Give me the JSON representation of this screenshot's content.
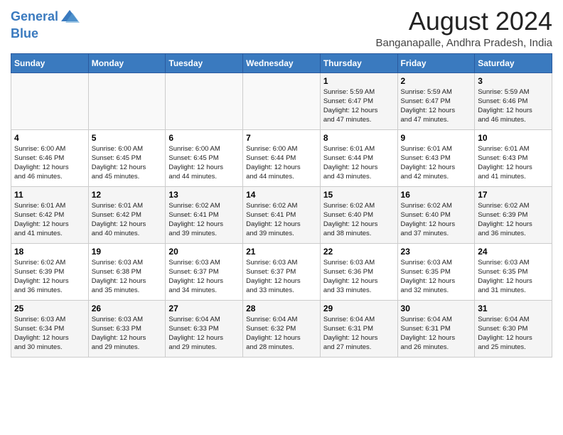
{
  "header": {
    "logo_line1": "General",
    "logo_line2": "Blue",
    "month": "August 2024",
    "location": "Banganapalle, Andhra Pradesh, India"
  },
  "days_of_week": [
    "Sunday",
    "Monday",
    "Tuesday",
    "Wednesday",
    "Thursday",
    "Friday",
    "Saturday"
  ],
  "weeks": [
    [
      {
        "day": "",
        "info": ""
      },
      {
        "day": "",
        "info": ""
      },
      {
        "day": "",
        "info": ""
      },
      {
        "day": "",
        "info": ""
      },
      {
        "day": "1",
        "info": "Sunrise: 5:59 AM\nSunset: 6:47 PM\nDaylight: 12 hours\nand 47 minutes."
      },
      {
        "day": "2",
        "info": "Sunrise: 5:59 AM\nSunset: 6:47 PM\nDaylight: 12 hours\nand 47 minutes."
      },
      {
        "day": "3",
        "info": "Sunrise: 5:59 AM\nSunset: 6:46 PM\nDaylight: 12 hours\nand 46 minutes."
      }
    ],
    [
      {
        "day": "4",
        "info": "Sunrise: 6:00 AM\nSunset: 6:46 PM\nDaylight: 12 hours\nand 46 minutes."
      },
      {
        "day": "5",
        "info": "Sunrise: 6:00 AM\nSunset: 6:45 PM\nDaylight: 12 hours\nand 45 minutes."
      },
      {
        "day": "6",
        "info": "Sunrise: 6:00 AM\nSunset: 6:45 PM\nDaylight: 12 hours\nand 44 minutes."
      },
      {
        "day": "7",
        "info": "Sunrise: 6:00 AM\nSunset: 6:44 PM\nDaylight: 12 hours\nand 44 minutes."
      },
      {
        "day": "8",
        "info": "Sunrise: 6:01 AM\nSunset: 6:44 PM\nDaylight: 12 hours\nand 43 minutes."
      },
      {
        "day": "9",
        "info": "Sunrise: 6:01 AM\nSunset: 6:43 PM\nDaylight: 12 hours\nand 42 minutes."
      },
      {
        "day": "10",
        "info": "Sunrise: 6:01 AM\nSunset: 6:43 PM\nDaylight: 12 hours\nand 41 minutes."
      }
    ],
    [
      {
        "day": "11",
        "info": "Sunrise: 6:01 AM\nSunset: 6:42 PM\nDaylight: 12 hours\nand 41 minutes."
      },
      {
        "day": "12",
        "info": "Sunrise: 6:01 AM\nSunset: 6:42 PM\nDaylight: 12 hours\nand 40 minutes."
      },
      {
        "day": "13",
        "info": "Sunrise: 6:02 AM\nSunset: 6:41 PM\nDaylight: 12 hours\nand 39 minutes."
      },
      {
        "day": "14",
        "info": "Sunrise: 6:02 AM\nSunset: 6:41 PM\nDaylight: 12 hours\nand 39 minutes."
      },
      {
        "day": "15",
        "info": "Sunrise: 6:02 AM\nSunset: 6:40 PM\nDaylight: 12 hours\nand 38 minutes."
      },
      {
        "day": "16",
        "info": "Sunrise: 6:02 AM\nSunset: 6:40 PM\nDaylight: 12 hours\nand 37 minutes."
      },
      {
        "day": "17",
        "info": "Sunrise: 6:02 AM\nSunset: 6:39 PM\nDaylight: 12 hours\nand 36 minutes."
      }
    ],
    [
      {
        "day": "18",
        "info": "Sunrise: 6:02 AM\nSunset: 6:39 PM\nDaylight: 12 hours\nand 36 minutes."
      },
      {
        "day": "19",
        "info": "Sunrise: 6:03 AM\nSunset: 6:38 PM\nDaylight: 12 hours\nand 35 minutes."
      },
      {
        "day": "20",
        "info": "Sunrise: 6:03 AM\nSunset: 6:37 PM\nDaylight: 12 hours\nand 34 minutes."
      },
      {
        "day": "21",
        "info": "Sunrise: 6:03 AM\nSunset: 6:37 PM\nDaylight: 12 hours\nand 33 minutes."
      },
      {
        "day": "22",
        "info": "Sunrise: 6:03 AM\nSunset: 6:36 PM\nDaylight: 12 hours\nand 33 minutes."
      },
      {
        "day": "23",
        "info": "Sunrise: 6:03 AM\nSunset: 6:35 PM\nDaylight: 12 hours\nand 32 minutes."
      },
      {
        "day": "24",
        "info": "Sunrise: 6:03 AM\nSunset: 6:35 PM\nDaylight: 12 hours\nand 31 minutes."
      }
    ],
    [
      {
        "day": "25",
        "info": "Sunrise: 6:03 AM\nSunset: 6:34 PM\nDaylight: 12 hours\nand 30 minutes."
      },
      {
        "day": "26",
        "info": "Sunrise: 6:03 AM\nSunset: 6:33 PM\nDaylight: 12 hours\nand 29 minutes."
      },
      {
        "day": "27",
        "info": "Sunrise: 6:04 AM\nSunset: 6:33 PM\nDaylight: 12 hours\nand 29 minutes."
      },
      {
        "day": "28",
        "info": "Sunrise: 6:04 AM\nSunset: 6:32 PM\nDaylight: 12 hours\nand 28 minutes."
      },
      {
        "day": "29",
        "info": "Sunrise: 6:04 AM\nSunset: 6:31 PM\nDaylight: 12 hours\nand 27 minutes."
      },
      {
        "day": "30",
        "info": "Sunrise: 6:04 AM\nSunset: 6:31 PM\nDaylight: 12 hours\nand 26 minutes."
      },
      {
        "day": "31",
        "info": "Sunrise: 6:04 AM\nSunset: 6:30 PM\nDaylight: 12 hours\nand 25 minutes."
      }
    ]
  ]
}
